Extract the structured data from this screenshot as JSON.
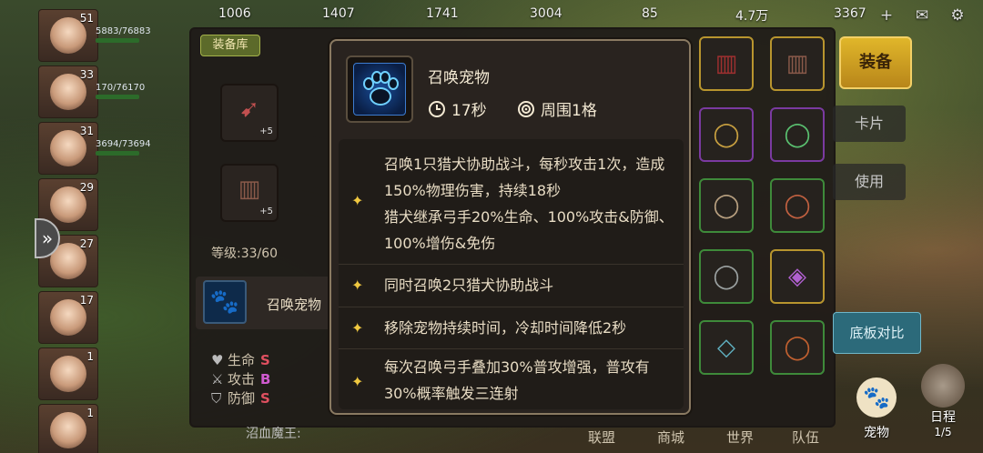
{
  "top_bar": {
    "res1": "1006",
    "res2": "1407",
    "res3": "1741",
    "res4": "3004",
    "res5": "85",
    "res6": "4.7万",
    "res7": "3367",
    "plus_icon": "plus-icon",
    "mail_icon": "mail-icon",
    "settings_icon": "gear-icon"
  },
  "roster": [
    {
      "level": "51",
      "hp": "5883/76883"
    },
    {
      "level": "33",
      "hp": "170/76170"
    },
    {
      "level": "31",
      "hp": "3694/73694"
    },
    {
      "level": "29",
      "hp": ""
    },
    {
      "level": "27",
      "hp": ""
    },
    {
      "level": "17",
      "hp": ""
    },
    {
      "level": "1",
      "hp": ""
    },
    {
      "level": "1",
      "hp": ""
    }
  ],
  "equipment_panel": {
    "tab": "装备库",
    "slot1_plus": "+5",
    "slot2_plus": "+5",
    "level_label": "等级:33/60",
    "skill_name": "召唤宠物",
    "stats": [
      {
        "label": "生命",
        "grade": "S"
      },
      {
        "label": "攻击",
        "grade": "B"
      },
      {
        "label": "防御",
        "grade": "S"
      }
    ]
  },
  "right_actions": {
    "equip_button": "装备",
    "card_button": "卡片",
    "use_button": "使用",
    "compare_button": "底板对比"
  },
  "tooltip": {
    "title": "召唤宠物",
    "cooldown": "17秒",
    "range": "周围1格",
    "lines": [
      "召唤1只猎犬协助战斗，每秒攻击1次，造成150%物理伤害，持续18秒\n猎犬继承弓手20%生命、100%攻击&防御、100%增伤&免伤",
      "同时召唤2只猎犬协助战斗",
      "移除宠物持续时间，冷却时间降低2秒",
      "每次召唤弓手叠加30%普攻增强，普攻有30%概率触发三连射"
    ]
  },
  "bottom_nav": {
    "items": [
      "联盟",
      "商城",
      "世界",
      "队伍"
    ],
    "pet": "宠物",
    "schedule": "日程",
    "schedule_count": "1/5",
    "chat": "沼血魔王:"
  },
  "colors": {
    "accent_gold": "#e0b62a",
    "star": "#f0c840",
    "grade_s": "#e05060",
    "grade_b": "#d05ad0"
  }
}
